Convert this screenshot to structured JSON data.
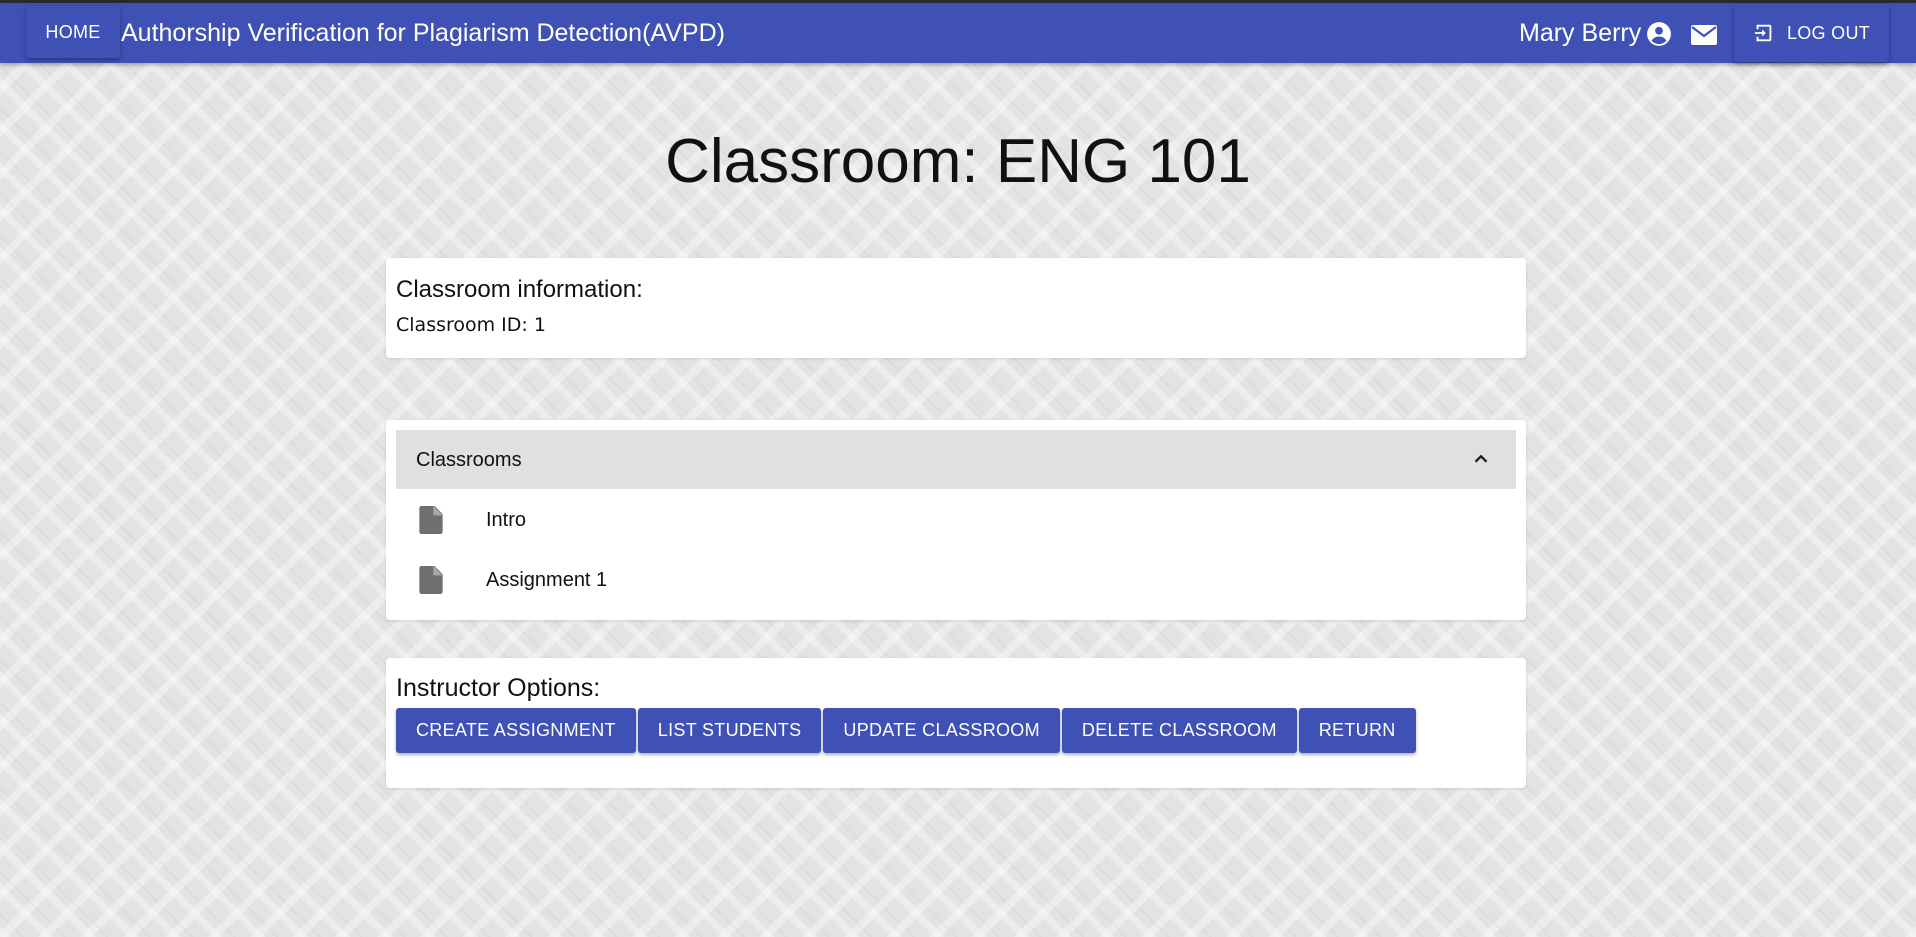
{
  "appbar": {
    "home_label": "HOME",
    "title": "Authorship Verification for Plagiarism Detection(AVPD)",
    "user_name": "Mary Berry",
    "logout_label": "LOG OUT",
    "color": "#3f51b5"
  },
  "page": {
    "title": "Classroom: ENG 101"
  },
  "info": {
    "heading": "Classroom information:",
    "classroom_id": "Classroom ID: 1"
  },
  "accordion": {
    "label": "Classrooms",
    "items": [
      {
        "label": "Intro",
        "icon": "file-icon"
      },
      {
        "label": "Assignment 1",
        "icon": "file-icon"
      }
    ]
  },
  "options": {
    "heading": "Instructor Options:",
    "buttons": [
      "CREATE ASSIGNMENT",
      "LIST STUDENTS",
      "UPDATE CLASSROOM",
      "DELETE CLASSROOM",
      "RETURN"
    ]
  }
}
